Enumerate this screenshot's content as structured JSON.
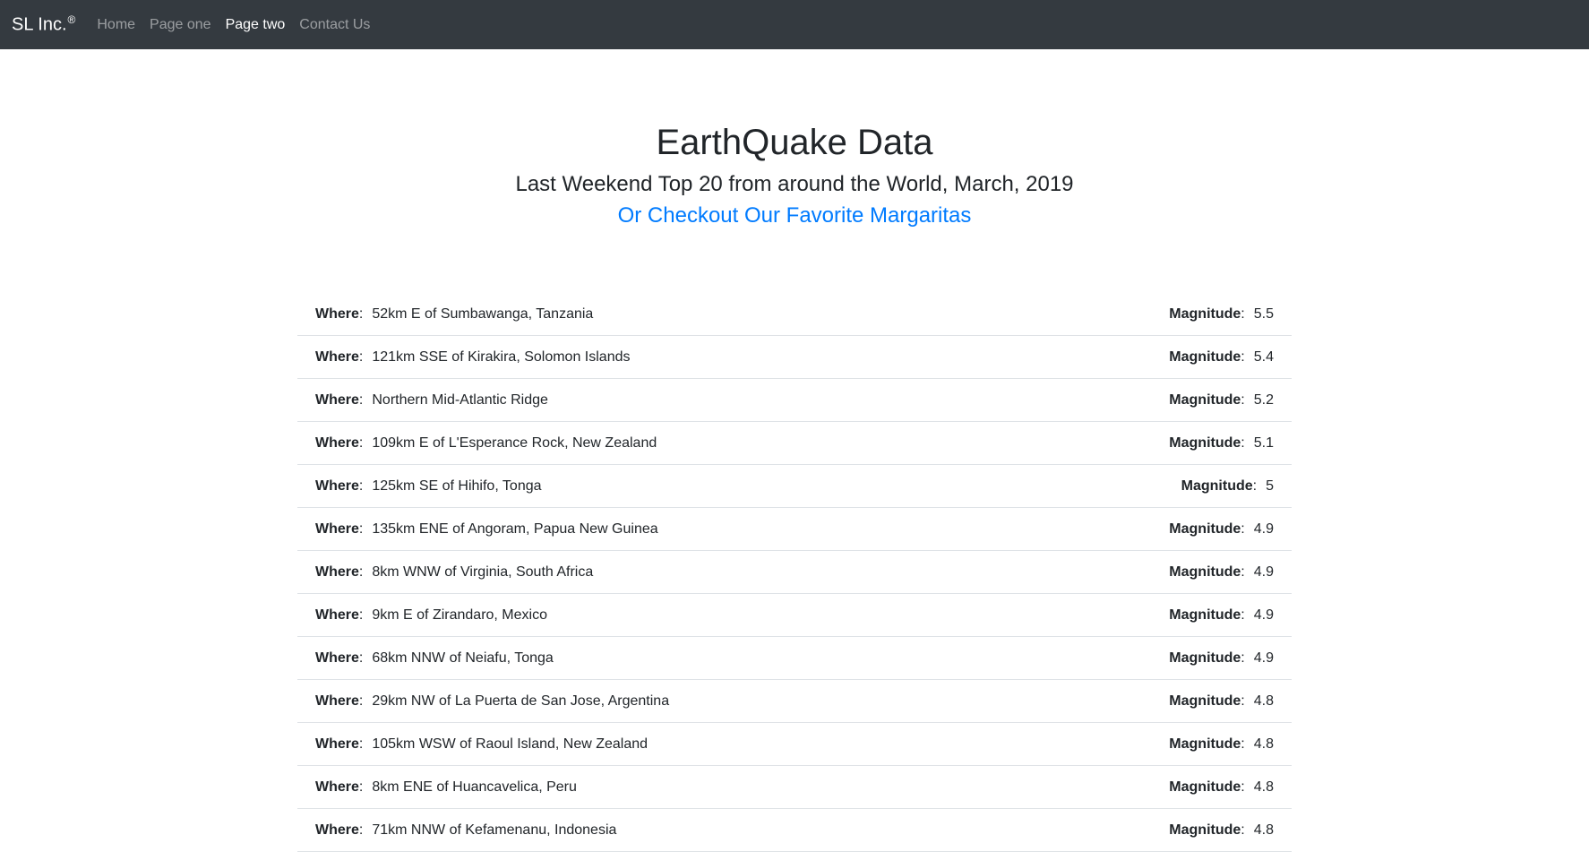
{
  "navbar": {
    "brand": "SL Inc.",
    "brand_mark": "®",
    "links": [
      {
        "label": "Home",
        "active": false
      },
      {
        "label": "Page one",
        "active": false
      },
      {
        "label": "Page two",
        "active": true
      },
      {
        "label": "Contact Us",
        "active": false
      }
    ]
  },
  "header": {
    "title": "EarthQuake Data",
    "subtitle": "Last Weekend Top 20 from around the World, March, 2019",
    "link_text": "Or Checkout Our Favorite Margaritas"
  },
  "labels": {
    "where": "Where",
    "magnitude": "Magnitude"
  },
  "quakes": [
    {
      "where": "52km E of Sumbawanga, Tanzania",
      "magnitude": "5.5"
    },
    {
      "where": "121km SSE of Kirakira, Solomon Islands",
      "magnitude": "5.4"
    },
    {
      "where": "Northern Mid-Atlantic Ridge",
      "magnitude": "5.2"
    },
    {
      "where": "109km E of L'Esperance Rock, New Zealand",
      "magnitude": "5.1"
    },
    {
      "where": "125km SE of Hihifo, Tonga",
      "magnitude": "5"
    },
    {
      "where": "135km ENE of Angoram, Papua New Guinea",
      "magnitude": "4.9"
    },
    {
      "where": "8km WNW of Virginia, South Africa",
      "magnitude": "4.9"
    },
    {
      "where": "9km E of Zirandaro, Mexico",
      "magnitude": "4.9"
    },
    {
      "where": "68km NNW of Neiafu, Tonga",
      "magnitude": "4.9"
    },
    {
      "where": "29km NW of La Puerta de San Jose, Argentina",
      "magnitude": "4.8"
    },
    {
      "where": "105km WSW of Raoul Island, New Zealand",
      "magnitude": "4.8"
    },
    {
      "where": "8km ENE of Huancavelica, Peru",
      "magnitude": "4.8"
    },
    {
      "where": "71km NNW of Kefamenanu, Indonesia",
      "magnitude": "4.8"
    }
  ],
  "colors": {
    "navbar_bg": "#343a40",
    "link": "#007bff",
    "row_border": "#dee2e6"
  }
}
